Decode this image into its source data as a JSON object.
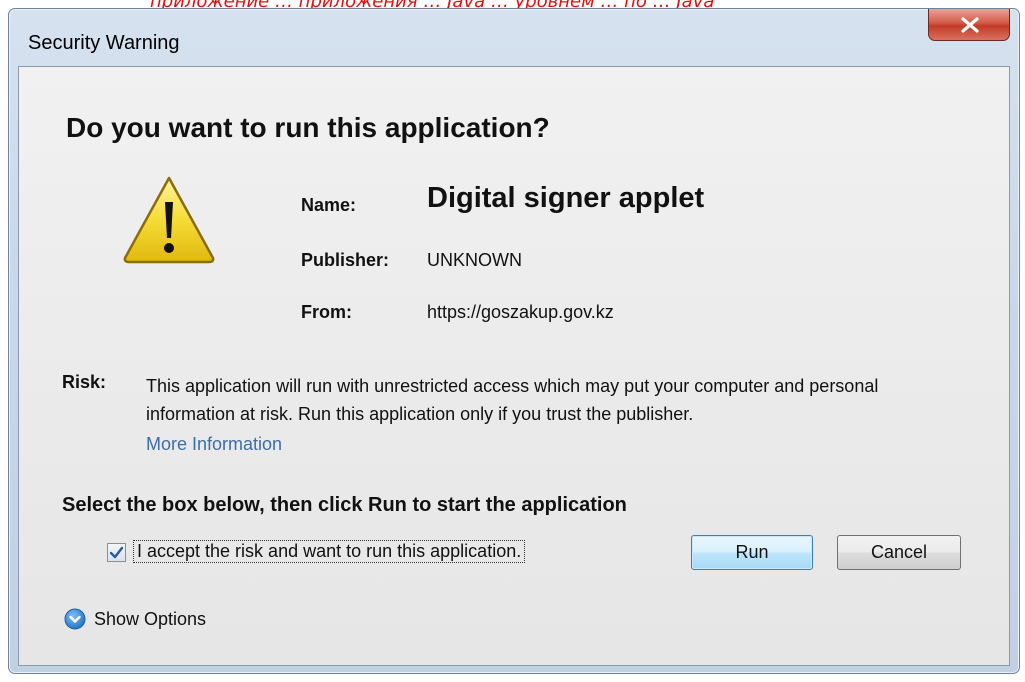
{
  "top_strip": {
    "text": "приложение … приложения … Java … уровнем … по … Java"
  },
  "window": {
    "title": "Security Warning",
    "close_icon": "close-x-icon"
  },
  "dialog": {
    "heading": "Do you want to run this application?",
    "icon": "warning-triangle-icon",
    "fields": {
      "name_label": "Name:",
      "name_value": "Digital signer applet",
      "publisher_label": "Publisher:",
      "publisher_value": "UNKNOWN",
      "from_label": "From:",
      "from_value": "https://goszakup.gov.kz"
    },
    "risk": {
      "label": "Risk:",
      "text": "This application will run with unrestricted access which may put your computer and personal information at risk. Run this application only if you trust the publisher.",
      "more_info_label": "More Information"
    },
    "instruction": "Select the box below, then click Run to start the application",
    "accept_checkbox": {
      "label": "I accept the risk and want to run this application.",
      "checked": true
    },
    "buttons": {
      "run": "Run",
      "cancel": "Cancel"
    },
    "show_options": {
      "label": "Show Options",
      "icon": "chevron-down-circle-icon"
    }
  },
  "colors": {
    "accent_blue": "#3c7fb1",
    "link": "#3c6ea8",
    "close_red": "#c13b27",
    "warning_yellow": "#f2d62e",
    "top_text_red": "#e01010"
  }
}
